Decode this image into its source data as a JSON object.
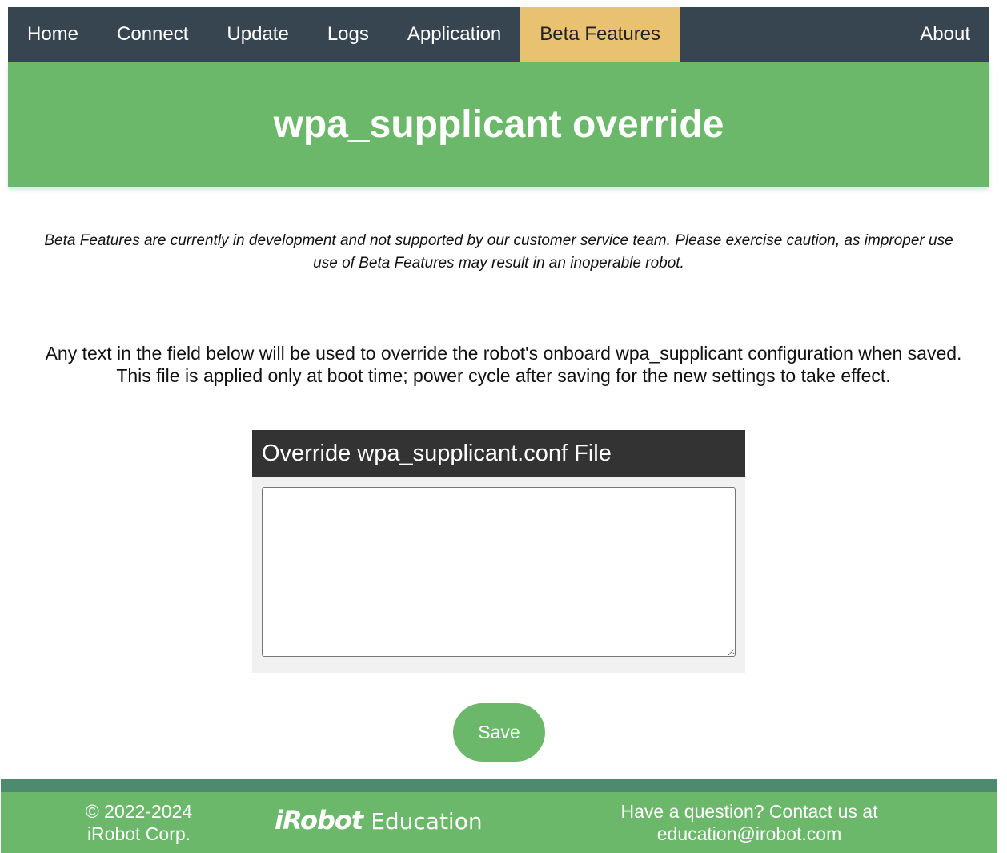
{
  "nav": {
    "items": [
      {
        "label": "Home"
      },
      {
        "label": "Connect"
      },
      {
        "label": "Update"
      },
      {
        "label": "Logs"
      },
      {
        "label": "Application"
      },
      {
        "label": "Beta Features",
        "active": true
      }
    ],
    "about_label": "About"
  },
  "page": {
    "title": "wpa_supplicant override",
    "disclaimer_line1": "Beta Features are currently in development and not supported by our customer service team. Please exercise caution, as improper use",
    "disclaimer_line2": "use of Beta Features may result in an inoperable robot.",
    "description_line1": "Any text in the field below will be used to override the robot's onboard wpa_supplicant configuration when saved.",
    "description_line2": "This file is applied only at boot time; power cycle after saving for the new settings to take effect."
  },
  "card": {
    "header": "Override wpa_supplicant.conf File",
    "textarea_value": ""
  },
  "actions": {
    "save_label": "Save"
  },
  "footer": {
    "copyright_line1": "© 2022-2024",
    "copyright_line2": "iRobot Corp.",
    "logo_brand": "iRobot",
    "logo_suffix": "Education",
    "contact_line1": "Have a question? Contact us at",
    "contact_email": "education@irobot.com"
  },
  "colors": {
    "nav_bg": "#36454f",
    "nav_active": "#e8c171",
    "accent_green": "#6cb86a",
    "card_header": "#333333"
  }
}
